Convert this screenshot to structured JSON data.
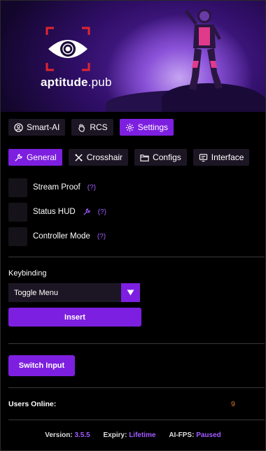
{
  "brand": {
    "name": "aptitude",
    "suffix": ".pub"
  },
  "main_tabs": [
    {
      "label": "Smart-AI",
      "icon": "user-circle-icon"
    },
    {
      "label": "RCS",
      "icon": "hand-icon"
    },
    {
      "label": "Settings",
      "icon": "gear-icon",
      "active": true
    }
  ],
  "sub_tabs": [
    {
      "label": "General",
      "icon": "wrench-icon",
      "active": true
    },
    {
      "label": "Crosshair",
      "icon": "crosshair-icon"
    },
    {
      "label": "Configs",
      "icon": "folder-icon"
    },
    {
      "label": "Interface",
      "icon": "monitor-icon"
    }
  ],
  "options": {
    "stream_proof": {
      "label": "Stream Proof",
      "help": "(?)",
      "checked": false
    },
    "status_hud": {
      "label": "Status HUD",
      "help": "(?)",
      "checked": false
    },
    "controller_mode": {
      "label": "Controller Mode",
      "help": "(?)",
      "checked": false
    }
  },
  "keybinding": {
    "title": "Keybinding",
    "selected": "Toggle Menu",
    "insert_label": "Insert"
  },
  "switch_input_label": "Switch Input",
  "users": {
    "label": "Users Online:",
    "count": "9"
  },
  "footer": {
    "version_label": "Version:",
    "version": "3.5.5",
    "expiry_label": "Expiry:",
    "expiry": "Lifetime",
    "aifps_label": "AI-FPS:",
    "aifps": "Paused"
  },
  "colors": {
    "accent": "#7d1fe0",
    "accent_text": "#a15bff",
    "count": "#e07b2c",
    "panel": "#1c1624"
  }
}
